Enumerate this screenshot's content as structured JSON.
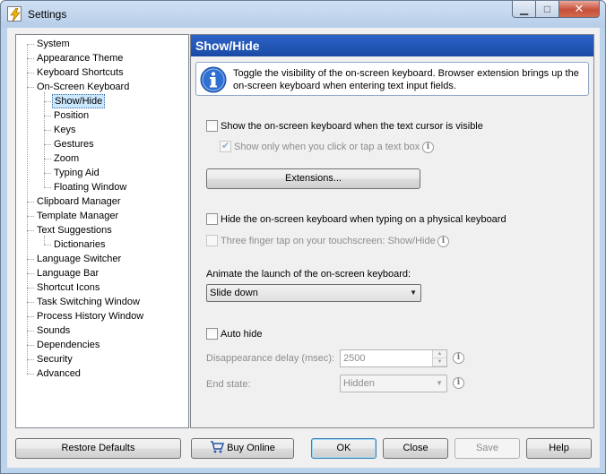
{
  "window": {
    "title": "Settings",
    "controls": {
      "minimize": "▭",
      "maximize": "▢",
      "close": "✕"
    }
  },
  "tree": {
    "items": [
      {
        "label": "System",
        "level": 0
      },
      {
        "label": "Appearance Theme",
        "level": 0
      },
      {
        "label": "Keyboard Shortcuts",
        "level": 0
      },
      {
        "label": "On-Screen Keyboard",
        "level": 0
      },
      {
        "label": "Show/Hide",
        "level": 1,
        "selected": true
      },
      {
        "label": "Position",
        "level": 1
      },
      {
        "label": "Keys",
        "level": 1
      },
      {
        "label": "Gestures",
        "level": 1
      },
      {
        "label": "Zoom",
        "level": 1
      },
      {
        "label": "Typing Aid",
        "level": 1
      },
      {
        "label": "Floating Window",
        "level": 1
      },
      {
        "label": "Clipboard Manager",
        "level": 0
      },
      {
        "label": "Template Manager",
        "level": 0
      },
      {
        "label": "Text Suggestions",
        "level": 0
      },
      {
        "label": "Dictionaries",
        "level": 1
      },
      {
        "label": "Language Switcher",
        "level": 0
      },
      {
        "label": "Language Bar",
        "level": 0
      },
      {
        "label": "Shortcut Icons",
        "level": 0
      },
      {
        "label": "Task Switching Window",
        "level": 0
      },
      {
        "label": "Process History Window",
        "level": 0
      },
      {
        "label": "Sounds",
        "level": 0
      },
      {
        "label": "Dependencies",
        "level": 0
      },
      {
        "label": "Security",
        "level": 0
      },
      {
        "label": "Advanced",
        "level": 0
      }
    ]
  },
  "panel": {
    "title": "Show/Hide",
    "info": "Toggle the visibility of the on-screen keyboard. Browser extension brings up the on-screen keyboard when entering text input fields.",
    "show_when_cursor": {
      "label": "Show the on-screen keyboard when the text cursor is visible",
      "checked": false
    },
    "show_only_click": {
      "label": "Show only when you click or tap a text box",
      "checked": true,
      "enabled": false
    },
    "extensions_button": "Extensions...",
    "hide_physical": {
      "label": "Hide the on-screen keyboard when typing on a physical keyboard",
      "checked": false
    },
    "three_finger": {
      "label": "Three finger tap on your touchscreen: Show/Hide",
      "checked": false,
      "enabled": false
    },
    "animate_label": "Animate the launch of the on-screen keyboard:",
    "animate_value": "Slide down",
    "auto_hide": {
      "label": "Auto hide",
      "checked": false
    },
    "delay_label": "Disappearance delay (msec):",
    "delay_value": "2500",
    "end_state_label": "End state:",
    "end_state_value": "Hidden",
    "help_glyph": "i"
  },
  "footer": {
    "restore_defaults": "Restore Defaults",
    "buy_online": "Buy Online",
    "ok": "OK",
    "close": "Close",
    "save": "Save",
    "help": "Help"
  },
  "colors": {
    "header_blue": "#1b4aa5",
    "selection": "#cce8ff"
  }
}
